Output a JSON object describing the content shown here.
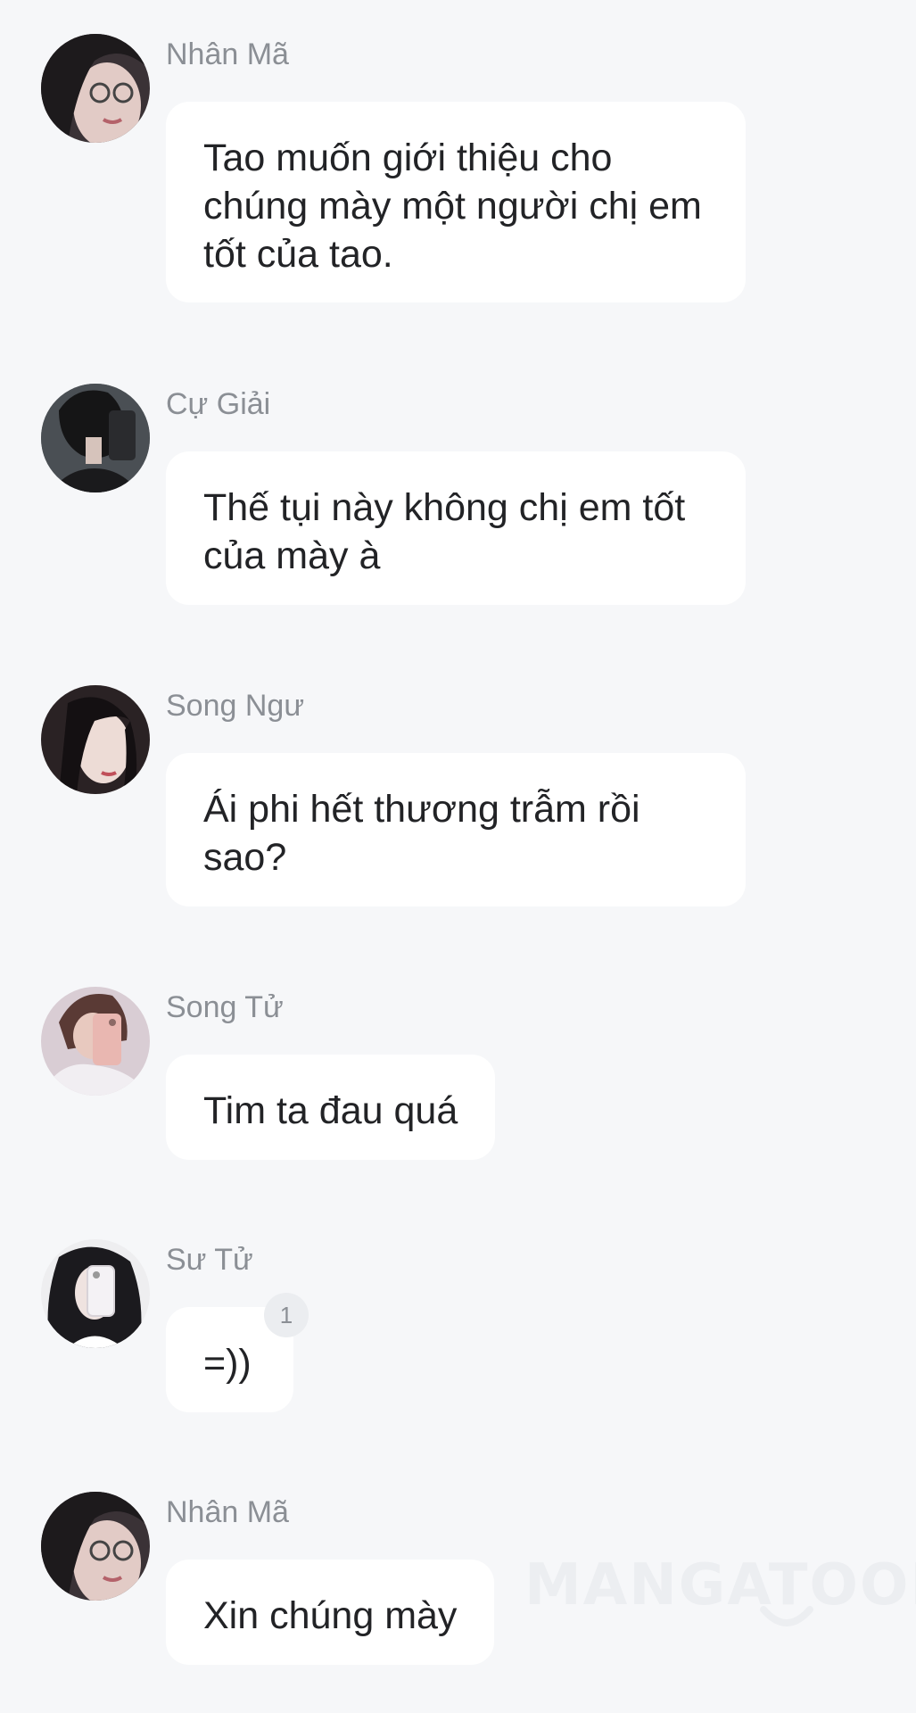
{
  "messages": [
    {
      "sender": "Nhân Mã",
      "text": "Tao muốn giới thiệu cho chúng mày một người chị em tốt của tao.",
      "avatar": "avatar-girl-glasses"
    },
    {
      "sender": "Cự Giải",
      "text": "Thế tụi này không chị em tốt của mày à",
      "avatar": "avatar-mirror-selfie-dark"
    },
    {
      "sender": "Song Ngư",
      "text": "Ái phi hết thương trẫm rồi sao?",
      "avatar": "avatar-girl-long-hair"
    },
    {
      "sender": "Song Tử",
      "text": "Tim ta đau quá",
      "avatar": "avatar-mirror-selfie-pink"
    },
    {
      "sender": "Sư Tử",
      "text": "=))",
      "avatar": "avatar-mirror-selfie-curly",
      "badge": "1"
    },
    {
      "sender": "Nhân Mã",
      "text": "Xin chúng mày",
      "avatar": "avatar-girl-glasses"
    }
  ],
  "watermark": "MANGATOON",
  "colors": {
    "background": "#f6f7f9",
    "bubble": "#ffffff",
    "sender": "#8b8f95",
    "text": "#222326"
  }
}
